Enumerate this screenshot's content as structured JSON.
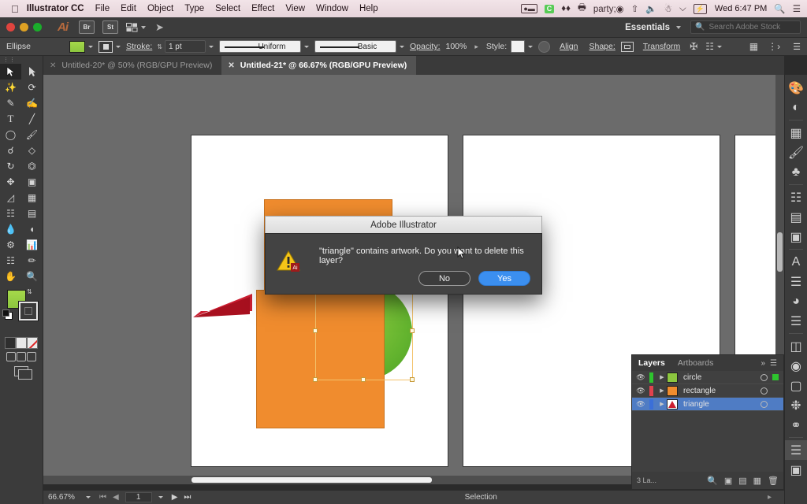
{
  "macbar": {
    "apple_icon": "apple-icon",
    "app_title": "Illustrator CC",
    "menus": [
      "File",
      "Edit",
      "Object",
      "Type",
      "Select",
      "Effect",
      "View",
      "Window",
      "Help"
    ],
    "status_icons": [
      "screen-record-icon",
      "evernote-icon",
      "dropbox-icon",
      "printer-icon",
      "backup-icon",
      "upload-icon",
      "volume-icon",
      "bluetooth-icon",
      "wifi-icon",
      "battery-icon"
    ],
    "evernote_badge": "C",
    "clock": "Wed 6:47 PM",
    "search_icon": "spotlight-search-icon",
    "notification_icon": "notification-center-icon"
  },
  "appbar": {
    "logo": "Ai",
    "bridge_label": "Br",
    "stock_label": "St",
    "arrange_label": "arrange-documents-icon",
    "sync_label": "sync-settings-icon",
    "workspace": "Essentials",
    "search_placeholder": "Search Adobe Stock",
    "search_icon": "search-icon"
  },
  "control_bar": {
    "selection_label": "Ellipse",
    "fill_color": "#8cc63f",
    "stroke_swatch": "stroke-swatch-icon",
    "stroke_label": "Stroke:",
    "stroke_weight": "1 pt",
    "variable_width_profile": "Uniform",
    "brush_definition": "Basic",
    "opacity_label": "Opacity:",
    "opacity_value": "100%",
    "style_label": "Style:",
    "opacity_mask_icon": "opacity-mask-icon",
    "align_label": "Align",
    "shape_label": "Shape:",
    "transform_label": "Transform",
    "isolate_icon": "isolate-selected-icon",
    "arrange_icon": "arrange-objects-icon",
    "grid_icon": "grid-icon",
    "distribute_icon": "distribute-icon",
    "menu_icon": "panel-menu-icon"
  },
  "tabs": [
    {
      "label": "Untitled-20* @ 50% (RGB/GPU Preview)",
      "active": false,
      "close_icon": "close-icon"
    },
    {
      "label": "Untitled-21* @ 66.67% (RGB/GPU Preview)",
      "active": true,
      "close_icon": "close-icon"
    }
  ],
  "toolbar": {
    "tools": [
      "selection-tool",
      "direct-selection-tool",
      "magic-wand-tool",
      "lasso-tool",
      "pen-tool",
      "curvature-tool",
      "type-tool",
      "line-segment-tool",
      "ellipse-tool",
      "paintbrush-tool",
      "shaper-tool",
      "eraser-tool",
      "rotate-tool",
      "scale-tool",
      "width-tool",
      "free-transform-tool",
      "shape-builder-tool",
      "perspective-grid-tool",
      "mesh-tool",
      "gradient-tool",
      "eyedropper-tool",
      "blend-tool",
      "symbol-sprayer-tool",
      "column-graph-tool",
      "artboard-tool",
      "slice-tool",
      "hand-tool",
      "zoom-tool"
    ],
    "fill_color": "#8cc63f",
    "stroke_color": "#ffffff",
    "swap_icon": "swap-fill-stroke-icon",
    "default_icon": "default-fill-stroke-icon",
    "color_modes": [
      "color-mode-icon",
      "gradient-mode-icon",
      "none-mode-icon"
    ],
    "draw_modes": [
      "draw-normal-icon",
      "draw-behind-icon",
      "draw-inside-icon"
    ],
    "screen_mode": "change-screen-mode-icon"
  },
  "canvas": {
    "artboards": 3,
    "shapes": [
      {
        "name": "rectangle-top",
        "color": "#f08c2e"
      },
      {
        "name": "rectangle-main",
        "color": "#f08c2e"
      },
      {
        "name": "triangle",
        "color": "#cc1f32"
      },
      {
        "name": "circle",
        "color": "#6fbb32",
        "selected": true
      }
    ],
    "selection_color": "#f3c26b"
  },
  "dock": {
    "items": [
      "color-panel-icon",
      "color-guide-icon",
      "swatches-panel-icon",
      "brushes-panel-icon",
      "symbols-panel-icon",
      "stroke-panel-icon",
      "gradient-panel-icon",
      "transparency-panel-icon",
      "appearance-panel-icon",
      "character-panel-icon",
      "paragraph-panel-icon",
      "opacity-panel-icon",
      "align-panel-icon",
      "pathfinder-panel-icon",
      "transform-panel-icon",
      "image-trace-icon",
      "libraries-panel-icon",
      "layers-panel-icon",
      "artboards-panel-icon"
    ]
  },
  "layers_panel": {
    "tabs": [
      {
        "label": "Layers",
        "selected": true
      },
      {
        "label": "Artboards",
        "selected": false
      }
    ],
    "collapse_icon": "collapse-panel-icon",
    "menu_icon": "panel-menu-icon",
    "rows": [
      {
        "name": "circle",
        "color": "#2ec42e",
        "thumb_color": "#8cc63f",
        "selected": false,
        "has_selection_square": true,
        "eye_icon": "eye-icon",
        "expand_icon": "disclosure-triangle-icon"
      },
      {
        "name": "rectangle",
        "color": "#e0424e",
        "thumb_color": "#f08c2e",
        "selected": false,
        "has_selection_square": false,
        "eye_icon": "eye-icon",
        "expand_icon": "disclosure-triangle-icon"
      },
      {
        "name": "triangle",
        "color": "#3b6fd8",
        "thumb_color": "#cc1f32",
        "selected": true,
        "has_selection_square": false,
        "eye_icon": "eye-icon",
        "expand_icon": "disclosure-triangle-icon"
      }
    ],
    "footer_count": "3 La...",
    "footer_icons": [
      "locate-object-icon",
      "make-mask-icon",
      "create-sublayer-icon",
      "create-layer-icon",
      "delete-layer-icon"
    ]
  },
  "status_bar": {
    "zoom": "66.67%",
    "artboard_number": "1",
    "first_icon": "first-artboard-icon",
    "prev_icon": "previous-artboard-icon",
    "next_icon": "next-artboard-icon",
    "last_icon": "last-artboard-icon",
    "tool_status": "Selection"
  },
  "dialog": {
    "title": "Adobe Illustrator",
    "message": "\"triangle\" contains artwork. Do you want to delete this layer?",
    "warning_icon": "warning-triangle-icon",
    "warning_badge": "Ai",
    "buttons": [
      {
        "label": "No",
        "primary": false
      },
      {
        "label": "Yes",
        "primary": true
      }
    ]
  },
  "cursor": {
    "icon": "mouse-pointer-icon"
  }
}
